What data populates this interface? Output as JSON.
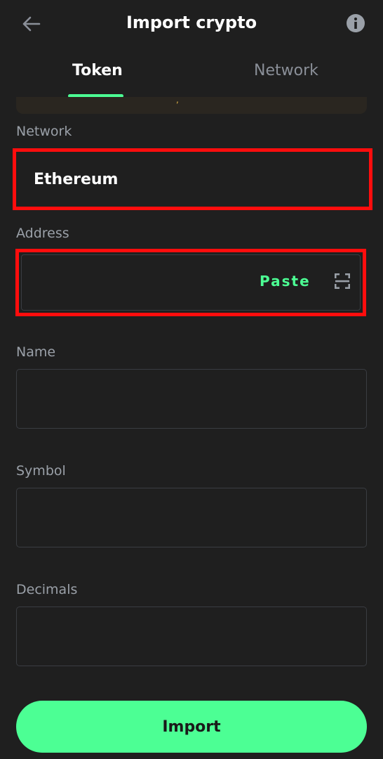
{
  "header": {
    "title": "Import crypto",
    "back_icon": "arrow-left-icon",
    "info_icon": "info-icon"
  },
  "tabs": [
    {
      "label": "Token",
      "active": true
    },
    {
      "label": "Network",
      "active": false
    }
  ],
  "form": {
    "network": {
      "label": "Network",
      "value": "Ethereum"
    },
    "address": {
      "label": "Address",
      "value": "",
      "paste_label": "Paste",
      "scan_icon": "scan-icon"
    },
    "name": {
      "label": "Name",
      "value": ""
    },
    "symbol": {
      "label": "Symbol",
      "value": ""
    },
    "decimals": {
      "label": "Decimals",
      "value": ""
    }
  },
  "actions": {
    "import_label": "Import"
  },
  "colors": {
    "background": "#1f1f1f",
    "accent": "#4cff94",
    "highlight": "#ff0d0d",
    "muted_text": "#9aa0a8",
    "field_border": "#3a3d42"
  }
}
